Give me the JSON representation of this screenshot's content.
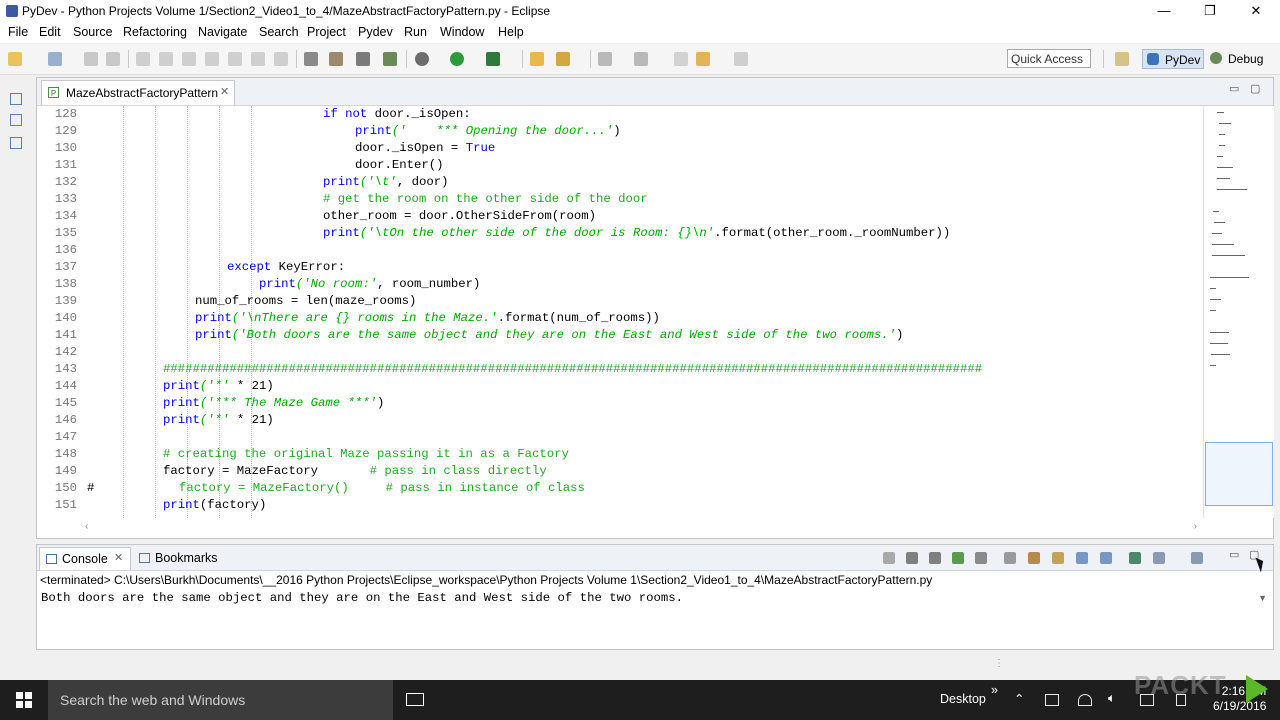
{
  "window": {
    "title": "PyDev - Python Projects Volume 1/Section2_Video1_to_4/MazeAbstractFactoryPattern.py - Eclipse",
    "minimize": "—",
    "maximize": "❐",
    "close": "✕"
  },
  "menu": [
    "File",
    "Edit",
    "Source",
    "Refactoring",
    "Navigate",
    "Search",
    "Project",
    "Pydev",
    "Run",
    "Window",
    "Help"
  ],
  "toolbar": {
    "quick_access": "Quick Access",
    "perspective_pydev": "PyDev",
    "perspective_debug": "Debug"
  },
  "editor": {
    "tab_label": "MazeAbstractFactoryPattern",
    "tab_close": "✕",
    "lines": [
      {
        "n": "128",
        "code": [
          {
            "t": "if not",
            "c": "kw"
          },
          {
            "t": " door._isOpen:",
            "c": ""
          }
        ],
        "indent": 29
      },
      {
        "n": "129",
        "code": [
          {
            "t": "print",
            "c": "kw"
          },
          {
            "t": "('    *** Opening the door...'",
            "c": "str"
          },
          {
            "t": ")",
            "c": ""
          }
        ],
        "indent": 33
      },
      {
        "n": "130",
        "code": [
          {
            "t": "door._isOpen = ",
            "c": ""
          },
          {
            "t": "True",
            "c": "kw"
          }
        ],
        "indent": 33
      },
      {
        "n": "131",
        "code": [
          {
            "t": "door.Enter()",
            "c": ""
          }
        ],
        "indent": 33
      },
      {
        "n": "132",
        "code": [
          {
            "t": "print",
            "c": "kw"
          },
          {
            "t": "('\\t'",
            "c": "str"
          },
          {
            "t": ", door)",
            "c": ""
          }
        ],
        "indent": 29
      },
      {
        "n": "133",
        "code": [
          {
            "t": "# get the room on the other side of the door",
            "c": "cmt"
          }
        ],
        "indent": 29
      },
      {
        "n": "134",
        "code": [
          {
            "t": "other_room = door.OtherSideFrom(room)",
            "c": ""
          }
        ],
        "indent": 29
      },
      {
        "n": "135",
        "code": [
          {
            "t": "print",
            "c": "kw"
          },
          {
            "t": "('\\tOn the other side of the door is Room: {}\\n'",
            "c": "str"
          },
          {
            "t": ".format(other_room._roomNumber))",
            "c": ""
          }
        ],
        "indent": 29
      },
      {
        "n": "136",
        "code": [],
        "indent": 0
      },
      {
        "n": "137",
        "code": [
          {
            "t": "except",
            "c": "kw"
          },
          {
            "t": " KeyError:",
            "c": ""
          }
        ],
        "indent": 17
      },
      {
        "n": "138",
        "code": [
          {
            "t": "print",
            "c": "kw"
          },
          {
            "t": "('No room:'",
            "c": "str"
          },
          {
            "t": ", room_number)",
            "c": ""
          }
        ],
        "indent": 21
      },
      {
        "n": "139",
        "code": [
          {
            "t": "num_of_rooms = len(maze_rooms)",
            "c": ""
          }
        ],
        "indent": 13
      },
      {
        "n": "140",
        "code": [
          {
            "t": "print",
            "c": "kw"
          },
          {
            "t": "('\\nThere are {} rooms in the Maze.'",
            "c": "str"
          },
          {
            "t": ".format(num_of_rooms))",
            "c": ""
          }
        ],
        "indent": 13
      },
      {
        "n": "141",
        "code": [
          {
            "t": "print",
            "c": "kw"
          },
          {
            "t": "('Both doors are the same object and they are on the East and West side of the two rooms.'",
            "c": "str"
          },
          {
            "t": ")",
            "c": ""
          }
        ],
        "indent": 13
      },
      {
        "n": "142",
        "code": [],
        "indent": 0
      },
      {
        "n": "143",
        "code": [
          {
            "t": "###############################################################################################################",
            "c": "cmt"
          }
        ],
        "indent": 9
      },
      {
        "n": "144",
        "code": [
          {
            "t": "print",
            "c": "kw"
          },
          {
            "t": "('*'",
            "c": "str"
          },
          {
            "t": " * 21)",
            "c": ""
          }
        ],
        "indent": 9
      },
      {
        "n": "145",
        "code": [
          {
            "t": "print",
            "c": "kw"
          },
          {
            "t": "('*** The Maze Game ***'",
            "c": "str"
          },
          {
            "t": ")",
            "c": ""
          }
        ],
        "indent": 9
      },
      {
        "n": "146",
        "code": [
          {
            "t": "print",
            "c": "kw"
          },
          {
            "t": "('*'",
            "c": "str"
          },
          {
            "t": " * 21)",
            "c": ""
          }
        ],
        "indent": 9
      },
      {
        "n": "147",
        "code": [],
        "indent": 0
      },
      {
        "n": "148",
        "code": [
          {
            "t": "# creating the original Maze passing it in as a Factory",
            "c": "cmt"
          }
        ],
        "indent": 9
      },
      {
        "n": "149",
        "code": [
          {
            "t": "factory = MazeFactory       ",
            "c": ""
          },
          {
            "t": "# pass in class directly",
            "c": "cmt"
          }
        ],
        "indent": 9
      },
      {
        "n": "150",
        "code": [
          {
            "t": "factory = MazeFactory()     ",
            "c": "cmt"
          },
          {
            "t": "# pass in instance of class",
            "c": "cmt"
          }
        ],
        "indent": 11,
        "marker": "#"
      },
      {
        "n": "151",
        "code": [
          {
            "t": "print",
            "c": "kw"
          },
          {
            "t": "(factory)",
            "c": ""
          }
        ],
        "indent": 9
      }
    ]
  },
  "console": {
    "tab_console": "Console",
    "tab_bookmarks": "Bookmarks",
    "tab_close": "✕",
    "path": "<terminated> C:\\Users\\Burkh\\Documents\\__2016 Python Projects\\Eclipse_workspace\\Python Projects Volume 1\\Section2_Video1_to_4\\MazeAbstractFactoryPattern.py",
    "output": "Both doors are the same object and they are on the East and West side of the two rooms."
  },
  "taskbar": {
    "search_placeholder": "Search the web and Windows",
    "desktop_label": "Desktop",
    "chevron": "»",
    "time": "2:16 PM",
    "date": "6/19/2016"
  },
  "watermark": "PACKT",
  "colors": {
    "keyword": "#0000ff",
    "string": "#00aa00",
    "comment": "#22aa22",
    "taskbar": "#1e1e1e"
  }
}
